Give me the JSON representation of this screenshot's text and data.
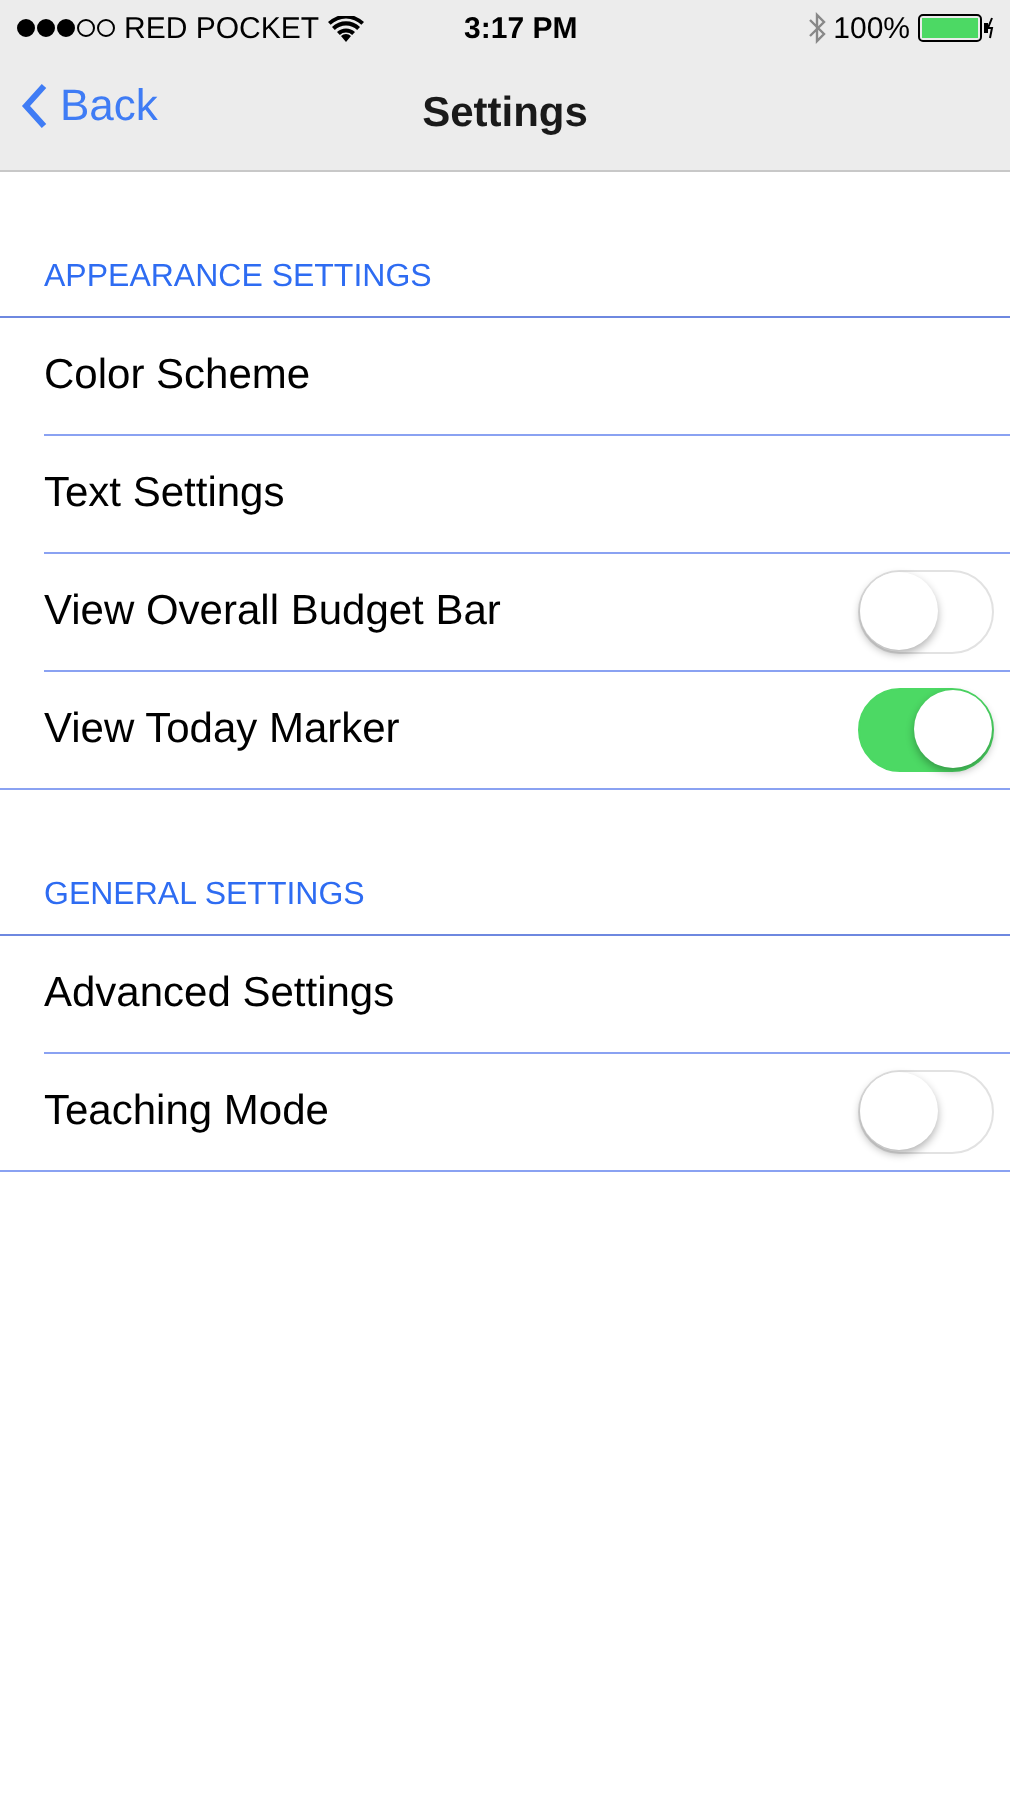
{
  "status_bar": {
    "carrier": "RED POCKET",
    "time": "3:17 PM",
    "battery": "100%"
  },
  "nav_bar": {
    "back": "Back",
    "title": "Settings"
  },
  "sections": [
    {
      "title": "APPEARANCE SETTINGS",
      "rows": [
        {
          "kind": "link",
          "label": "Color Scheme"
        },
        {
          "kind": "link",
          "label": "Text Settings"
        },
        {
          "kind": "toggle",
          "label": "View Overall Budget Bar",
          "on": false
        },
        {
          "kind": "toggle",
          "label": "View Today Marker",
          "on": true
        }
      ]
    },
    {
      "title": "GENERAL SETTINGS",
      "rows": [
        {
          "kind": "link",
          "label": "Advanced Settings"
        },
        {
          "kind": "toggle",
          "label": "Teaching Mode",
          "on": false
        }
      ]
    }
  ]
}
